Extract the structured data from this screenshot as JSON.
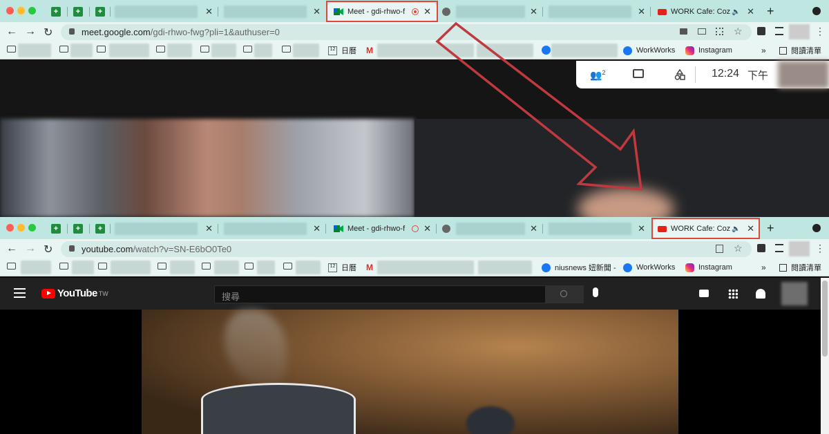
{
  "window_top": {
    "tabs": [
      {
        "label": "Meet - gdi-rhwo-f"
      }
    ],
    "url": {
      "host": "meet.google.com",
      "path": "/gdi-rhwo-fwg?pli=1&authuser=0"
    },
    "bookmarks": {
      "calendar": "日曆",
      "workworks": "WorkWorks",
      "instagram": "Instagram",
      "reading_list": "閱讀清單"
    },
    "meet_bar": {
      "people_count": "2",
      "time": "12:24",
      "ampm": "下午"
    }
  },
  "window_bottom": {
    "tabs": [
      {
        "label": "Meet - gdi-rhwo-f"
      },
      {
        "label": "WORK Cafe: Cozy"
      }
    ],
    "url": {
      "host": "youtube.com",
      "path": "/watch?v=SN-E6bO0Te0"
    },
    "bookmarks": {
      "calendar": "日曆",
      "niusnews": "niusnews 妞新聞 -",
      "workworks": "WorkWorks",
      "instagram": "Instagram",
      "reading_list": "閱讀清單"
    },
    "youtube": {
      "logo_text": "YouTube",
      "region": "TW",
      "search_placeholder": "搜尋"
    }
  },
  "window_top_tab_work": "WORK Cafe: Cozy",
  "colors": {
    "tabbar": "#bfe6e0",
    "highlight": "#e0473c",
    "youtube_red": "#ff0000"
  }
}
